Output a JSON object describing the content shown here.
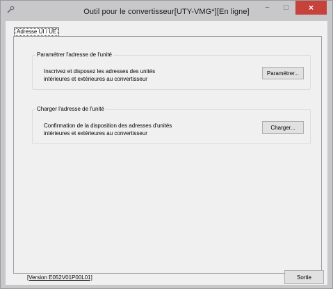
{
  "window": {
    "title": "Outil pour le convertisseur[UTY-VMG*][En ligne]",
    "close_symbol": "×",
    "minimize_symbol": "−",
    "maximize_symbol": "□"
  },
  "tabs": [
    {
      "label": "Adresse UI / UE"
    }
  ],
  "groups": {
    "set": {
      "title": "Paramétrer l'adresse de l'unité",
      "desc_line1": "Inscrivez et disposez les adresses des unités",
      "desc_line2": "intérieures et extérieures au convertisseur",
      "button": "Paramétrer..."
    },
    "load": {
      "title": "Charger l'adresse de l'unité",
      "desc_line1": "Confirmation de la disposition des adresses d'unités",
      "desc_line2": "intérieures et extérieures au convertisseur",
      "button": "Charger..."
    }
  },
  "footer": {
    "version": "[Version E052V01P00L01]",
    "exit_button": "Sortie"
  },
  "colors": {
    "close_button": "#c7423b",
    "window_frame": "#c8c8cb"
  },
  "icons": {
    "app": "wrench-icon"
  }
}
